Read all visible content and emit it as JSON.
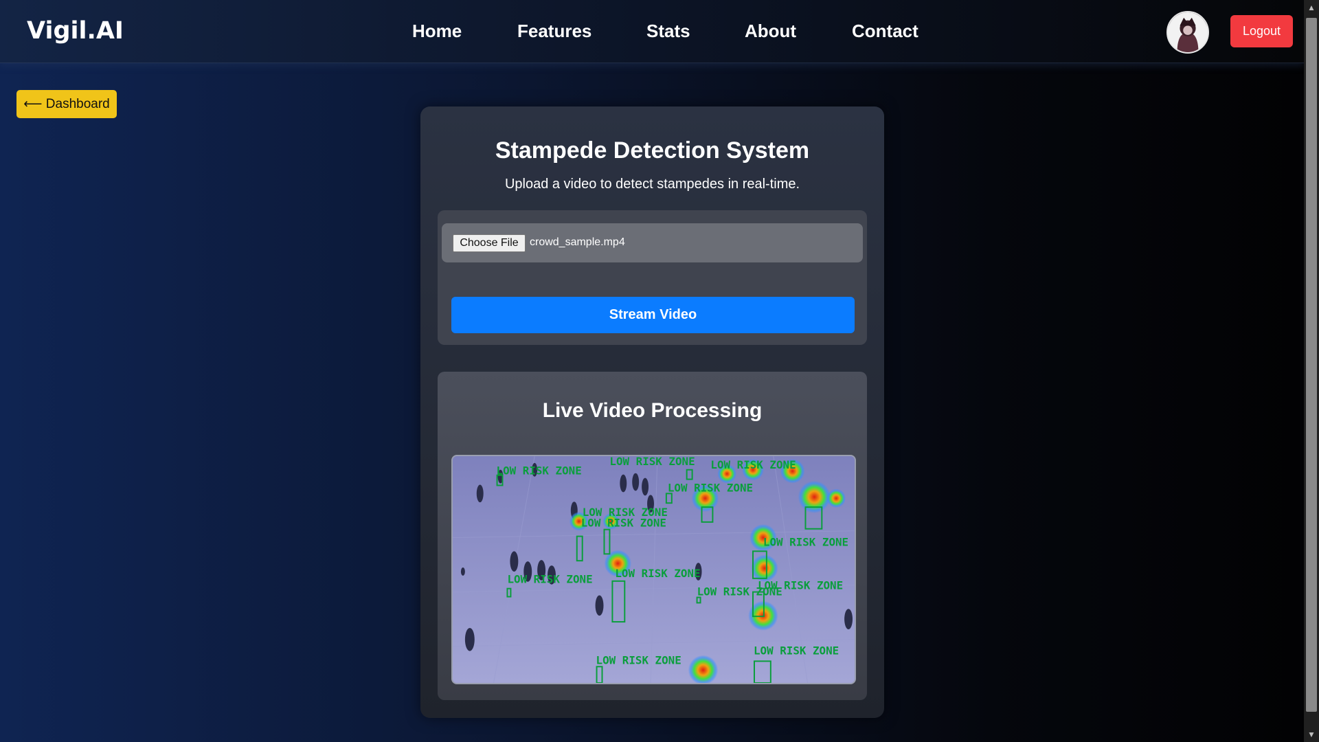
{
  "navbar": {
    "brand": "Vigil.AI",
    "links": [
      "Home",
      "Features",
      "Stats",
      "About",
      "Contact"
    ],
    "logout_label": "Logout"
  },
  "back_button": {
    "label": "⟵ Dashboard"
  },
  "card": {
    "title": "Stampede Detection System",
    "subtitle": "Upload a video to detect stampedes in real-time.",
    "file_button_label": "Choose File",
    "file_name": "crowd_sample.mp4",
    "stream_label": "Stream Video",
    "video_title": "Live Video Processing",
    "zone_label": "LOW RISK ZONE"
  },
  "colors": {
    "accent_blue": "#0b7cff",
    "logout_red": "#f23a3f",
    "dashboard_yellow": "#f0c419",
    "zone_green": "#0a9e3c"
  }
}
